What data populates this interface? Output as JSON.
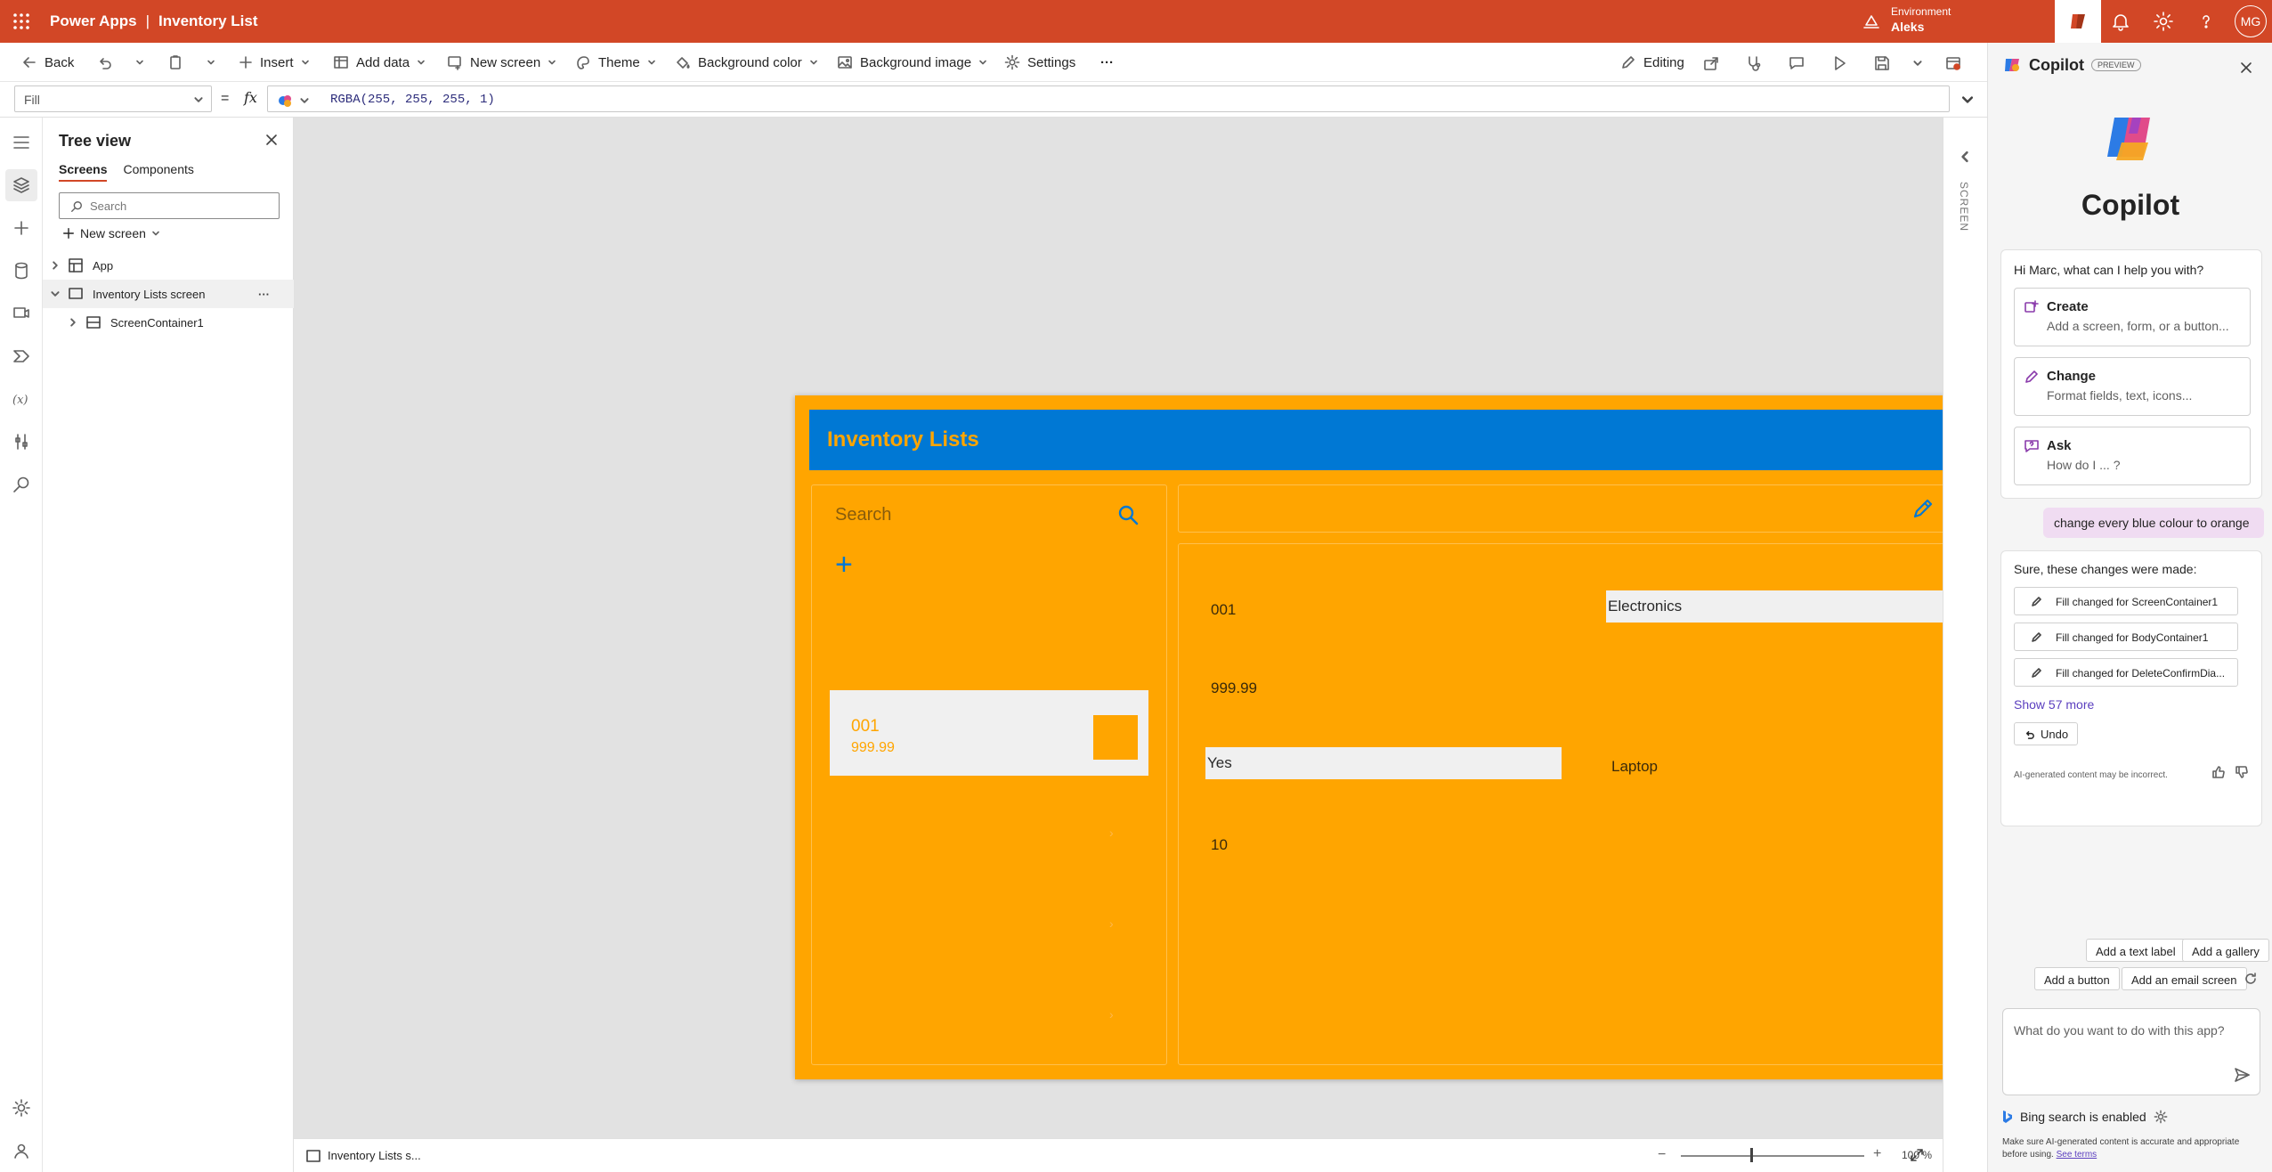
{
  "colors": {
    "brand": "#d24726",
    "app_orange": "#ffa500",
    "app_blue": "#0078d4",
    "canvas": "#e2e2e2"
  },
  "topbar": {
    "app_name": "Power Apps",
    "separator": "|",
    "document_name": "Inventory List",
    "environment_label": "Environment",
    "environment_name": "Aleks",
    "avatar_initials": "MG"
  },
  "toolbar": {
    "back": "Back",
    "insert": "Insert",
    "add_data": "Add data",
    "new_screen": "New screen",
    "theme": "Theme",
    "background_color": "Background color",
    "background_image": "Background image",
    "settings": "Settings",
    "more": "···",
    "editing": "Editing"
  },
  "formula": {
    "property": "Fill",
    "equals": "=",
    "fx": "fx",
    "value": "RGBA(255, 255, 255, 1)"
  },
  "tree": {
    "title": "Tree view",
    "tabs": [
      "Screens",
      "Components"
    ],
    "search_placeholder": "Search",
    "new_screen": "New screen",
    "nodes": [
      "App",
      "Inventory Lists screen",
      "ScreenContainer1"
    ],
    "more": "···"
  },
  "app": {
    "title": "Inventory Lists",
    "search_placeholder": "Search",
    "add": "+",
    "item": {
      "id": "001",
      "price": "999.99"
    },
    "fields": {
      "id": "001",
      "category": "Electronics",
      "price": "999.99",
      "flag": "Yes",
      "name": "Laptop",
      "qty": "10"
    }
  },
  "right_strip": {
    "label": "SCREEN"
  },
  "statusbar": {
    "screen_name": "Inventory Lists s...",
    "zoom": "100 %",
    "minus": "−",
    "plus": "+"
  },
  "copilot": {
    "title": "Copilot",
    "badge": "PREVIEW",
    "big_title": "Copilot",
    "greeting": "Hi Marc, what can I help you with?",
    "options": [
      {
        "title": "Create",
        "subtitle": "Add a screen, form, or a button..."
      },
      {
        "title": "Change",
        "subtitle": "Format fields, text, icons..."
      },
      {
        "title": "Ask",
        "subtitle": "How do I ... ?"
      }
    ],
    "user_message": "change every blue colour to orange",
    "response_intro": "Sure, these changes were made:",
    "changes": [
      "Fill changed for ScreenContainer1",
      "Fill changed for BodyContainer1",
      "Fill changed for DeleteConfirmDia..."
    ],
    "show_more": "Show 57 more",
    "undo": "Undo",
    "disclaimer": "AI-generated content may be incorrect.",
    "suggestions": [
      "Add a text label",
      "Add a gallery",
      "Add a button",
      "Add an email screen"
    ],
    "input_placeholder": "What do you want to do with this app?",
    "bing": "Bing search is enabled",
    "footer1": "Make sure AI-generated content is accurate and appropriate",
    "footer2": "before using.",
    "terms": "See terms"
  }
}
